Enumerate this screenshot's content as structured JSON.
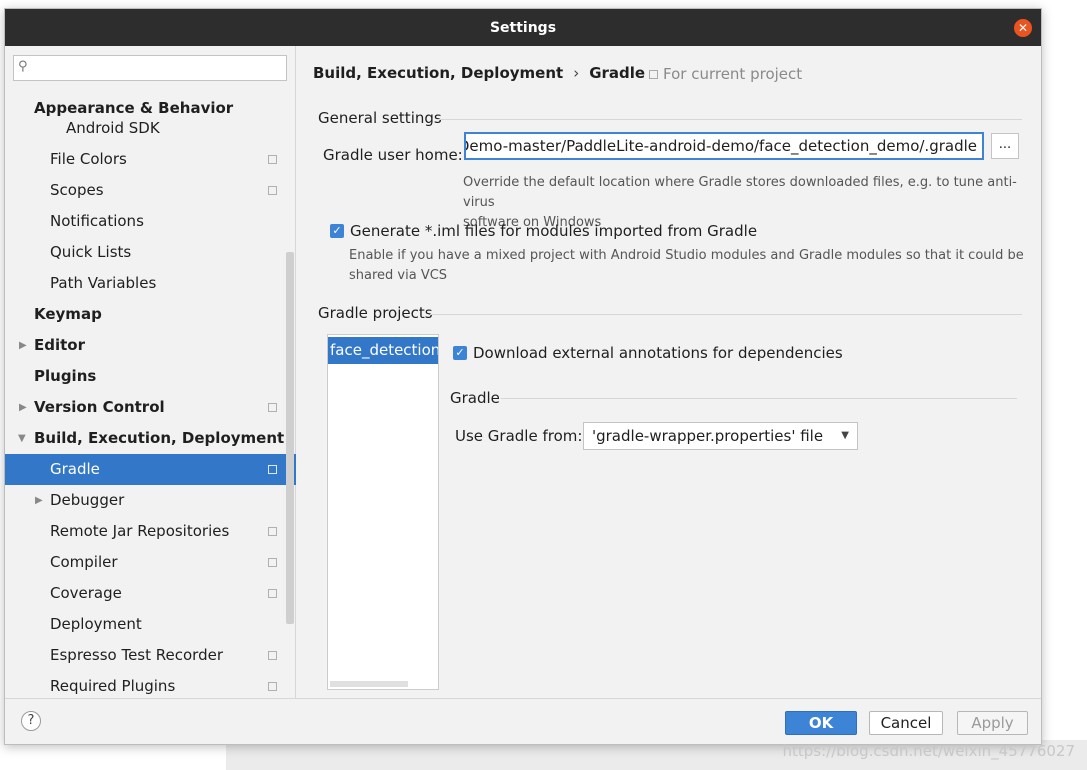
{
  "window": {
    "title": "Settings"
  },
  "search": {
    "placeholder": ""
  },
  "sidebar": {
    "items": [
      {
        "label": "Appearance & Behavior",
        "bold": true
      },
      {
        "label": "Android SDK"
      },
      {
        "label": "File Colors",
        "project": true
      },
      {
        "label": "Scopes",
        "project": true
      },
      {
        "label": "Notifications"
      },
      {
        "label": "Quick Lists"
      },
      {
        "label": "Path Variables"
      },
      {
        "label": "Keymap",
        "bold": true
      },
      {
        "label": "Editor",
        "bold": true,
        "arrow": "right"
      },
      {
        "label": "Plugins",
        "bold": true
      },
      {
        "label": "Version Control",
        "bold": true,
        "arrow": "right",
        "project": true
      },
      {
        "label": "Build, Execution, Deployment",
        "bold": true,
        "arrow": "down"
      },
      {
        "label": "Gradle",
        "selected": true,
        "project": true
      },
      {
        "label": "Debugger",
        "arrow": "right"
      },
      {
        "label": "Remote Jar Repositories",
        "project": true
      },
      {
        "label": "Compiler",
        "project": true
      },
      {
        "label": "Coverage",
        "project": true
      },
      {
        "label": "Deployment"
      },
      {
        "label": "Espresso Test Recorder",
        "project": true
      },
      {
        "label": "Required Plugins",
        "project": true
      }
    ]
  },
  "main": {
    "breadcrumb": [
      "Build, Execution, Deployment",
      "Gradle"
    ],
    "breadcrumb_sep": "›",
    "for_current_project": "For current project",
    "general_settings": {
      "title": "General settings",
      "gradle_user_home_label": "Gradle user home:",
      "gradle_user_home_value": ":e-Demo-master/PaddleLite-android-demo/face_detection_demo/.gradle",
      "browse_label": "...",
      "gradle_user_home_hint_1": "Override the default location where Gradle stores downloaded files, e.g. to tune anti-virus",
      "gradle_user_home_hint_2": "software on Windows",
      "generate_iml_label": "Generate *.iml files for modules imported from Gradle",
      "generate_iml_checked": true,
      "generate_iml_hint_1": "Enable if you have a mixed project with Android Studio modules and Gradle modules so that it could be",
      "generate_iml_hint_2": "shared via VCS"
    },
    "gradle_projects": {
      "title": "Gradle projects",
      "projects": [
        "face_detection_"
      ],
      "download_annotations_label": "Download external annotations for dependencies",
      "download_annotations_checked": true,
      "gradle_section_title": "Gradle",
      "use_gradle_from_label": "Use Gradle from:",
      "use_gradle_from_value": "'gradle-wrapper.properties' file"
    }
  },
  "footer": {
    "help_label": "?",
    "ok_label": "OK",
    "cancel_label": "Cancel",
    "apply_label": "Apply"
  },
  "watermark": "https://blog.csdn.net/weixin_45776027",
  "colors": {
    "title_bar": "#2d2d2d",
    "close_button": "#e95420",
    "selection": "#3277c8",
    "accent": "#3d84d6"
  }
}
